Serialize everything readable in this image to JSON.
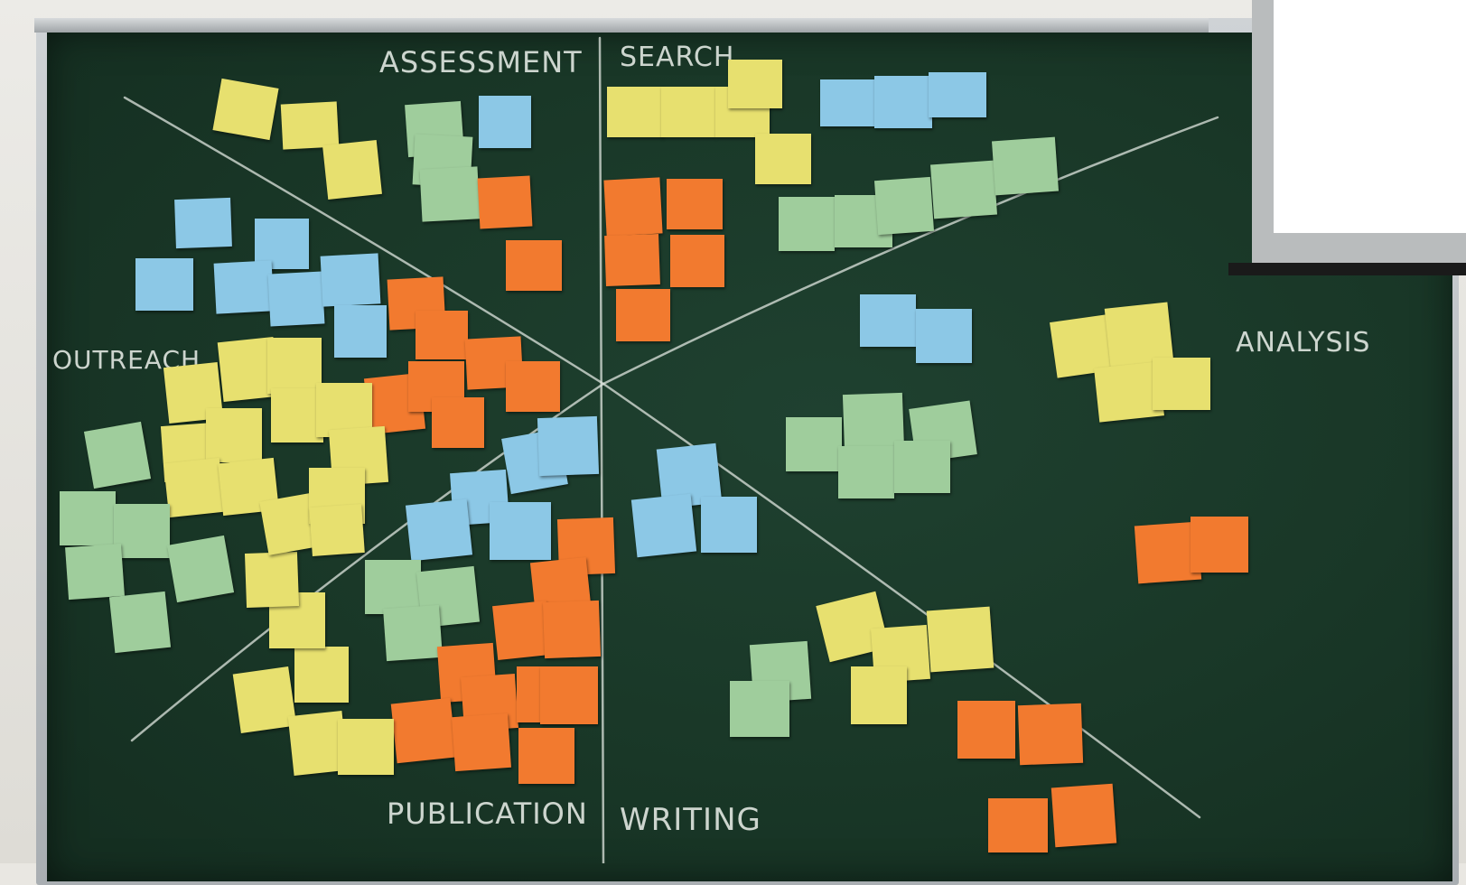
{
  "board": {
    "colors": {
      "board": "#1b3a29",
      "chalk": "#e6ece6",
      "yellow": "#e7e06f",
      "blue": "#8cc8e6",
      "orange": "#f27a2f",
      "green": "#9fcd9c"
    }
  },
  "labels": {
    "assessment": "ASSESSMENT",
    "search": "SEARCH",
    "outreach": "OUTREACH",
    "analysis": "ANALYSIS",
    "publication": "PUBLICATION",
    "writing": "WRITING"
  }
}
